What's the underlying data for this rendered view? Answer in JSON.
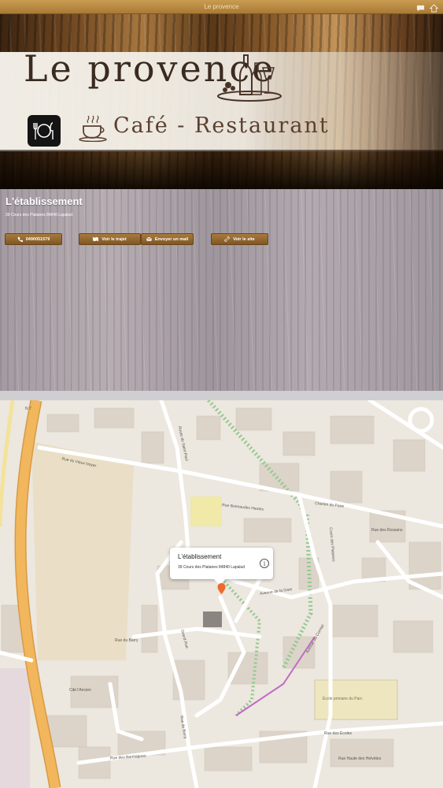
{
  "topbar": {
    "title": "Le provence"
  },
  "banner": {
    "logo_title": "Le provence",
    "logo_subtitle": "Café - Restaurant"
  },
  "info": {
    "title": "L'établissement",
    "address": "39 Cours des Platanes 84840 Lapalud",
    "buttons": {
      "phone": "0490051579",
      "route": "Voir le trajet",
      "email": "Envoyer un mail",
      "site": "Voir le site"
    }
  },
  "map": {
    "callout_title": "L'établissement",
    "callout_address": "39 Cours des Platanes 84840 Lapalud",
    "streets": {
      "vieux_noyer": "Rue du Vieux Noyer",
      "barry": "Rue du Barry",
      "grand_rue": "Grand Rue",
      "bonnaudes": "Rue Bonnaudes Hautes",
      "bonnaudes_2": "Rue Bonnaudes Hautes",
      "chemin_paire": "Chemin du Paire",
      "rossans": "Rue des Rossans",
      "ancien": "Cité l'Ancien",
      "cours_platanes": "Cours des Platanes",
      "route_saint_paul": "Route de Saint-Paul",
      "av_comtat": "Avenue du Comtat",
      "av_gare": "Avenue de la Gare",
      "ecoles": "Rue des Écoles",
      "haute_helvetes": "Rue Haute des Helvètes",
      "barmagues": "Rue des Barmagues",
      "barry_2": "Rue du Barry",
      "ecole_label": "École primaire du Parc",
      "n7": "N 7"
    },
    "colors": {
      "road_major": "#f2b65c",
      "road_border": "#d79a45",
      "building": "#d9d2c7",
      "park": "#ebe3c4",
      "green": "#8bc48a"
    }
  }
}
